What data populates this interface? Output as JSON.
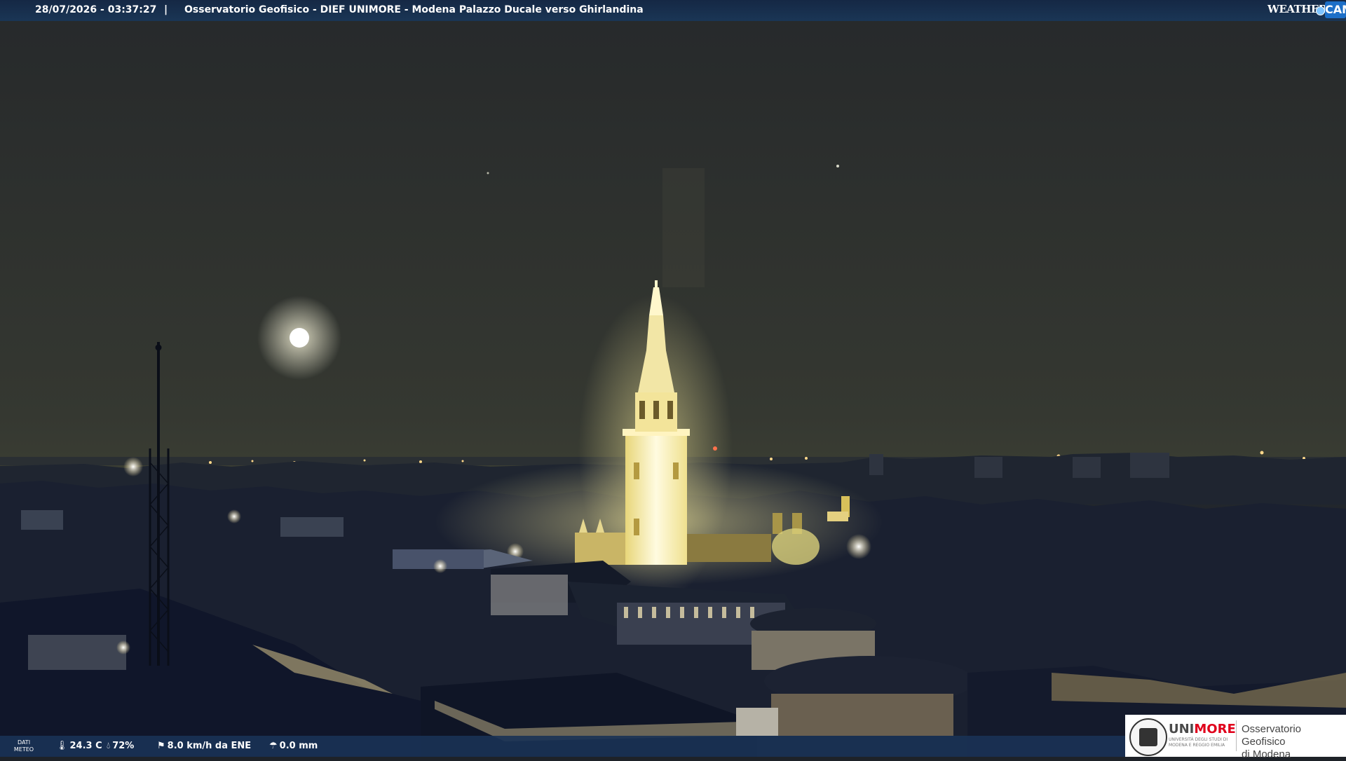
{
  "header": {
    "timestamp": "28/07/2026 - 03:37:27",
    "separator": "|",
    "title": "Osservatorio Geofisico - DIEF UNIMORE - Modena Palazzo Ducale verso Ghirlandina"
  },
  "logo": {
    "weather": "WEATHER",
    "cam": "CAM"
  },
  "weather_bar": {
    "label_line1": "DATI",
    "label_line2": "METEO",
    "temperature": "24.3 C",
    "humidity": "72%",
    "wind": "8.0 km/h da ENE",
    "rain": "0.0 mm",
    "icons": {
      "temperature": "thermometer-icon",
      "humidity": "drop-icon",
      "wind": "windsock-icon",
      "rain": "rain-gauge-icon"
    }
  },
  "partner_logo": {
    "brand_part1": "UNI",
    "brand_part2": "MORE",
    "subtitle": "UNIVERSITÀ DEGLI STUDI DI MODENA E REGGIO EMILIA",
    "observatory_line1": "Osservatorio Geofisico",
    "observatory_line2": "di Modena"
  },
  "colors": {
    "sky": "#30332e",
    "tower_light": "#fff6c8",
    "more_red": "#e0001b"
  }
}
